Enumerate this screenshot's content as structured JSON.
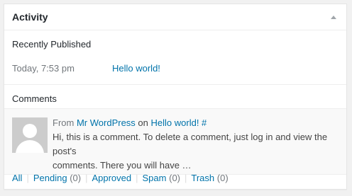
{
  "widget": {
    "title": "Activity"
  },
  "recently_published": {
    "heading": "Recently Published",
    "items": [
      {
        "date": "Today, 7:53 pm",
        "title": "Hello world!"
      }
    ]
  },
  "comments": {
    "heading": "Comments",
    "items": [
      {
        "from_prefix": "From",
        "author": "Mr WordPress",
        "on_word": "on",
        "post_link": "Hello world! #",
        "text_line1": "Hi, this is a comment. To delete a comment, just log in and view the post's",
        "text_line2": "comments. There you will have …"
      }
    ]
  },
  "filters": [
    {
      "label": "All",
      "count": ""
    },
    {
      "label": "Pending",
      "count": "(0)"
    },
    {
      "label": "Approved",
      "count": ""
    },
    {
      "label": "Spam",
      "count": "(0)"
    },
    {
      "label": "Trash",
      "count": "(0)"
    }
  ],
  "colors": {
    "link": "#0073aa",
    "muted": "#72777c",
    "heading": "#23282d"
  }
}
